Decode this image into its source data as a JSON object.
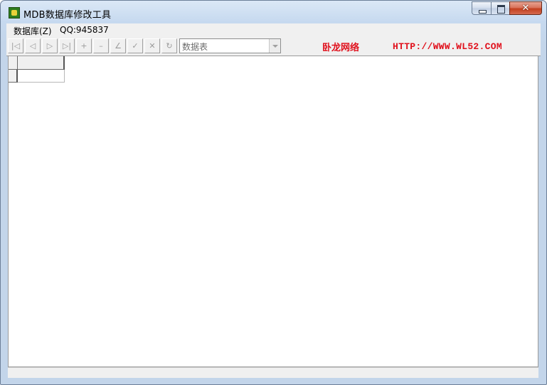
{
  "window": {
    "title": "MDB数据库修改工具",
    "icon": "app-icon",
    "close_glyph": "✕"
  },
  "menu": {
    "items": [
      {
        "label": "数据库(Z)"
      },
      {
        "label": "QQ:945837"
      }
    ]
  },
  "toolbar": {
    "buttons": [
      {
        "icon": "first-record-icon",
        "glyph": "|◁"
      },
      {
        "icon": "prior-record-icon",
        "glyph": "◁"
      },
      {
        "icon": "next-record-icon",
        "glyph": "▷"
      },
      {
        "icon": "last-record-icon",
        "glyph": "▷|"
      },
      {
        "icon": "insert-record-icon",
        "glyph": "+"
      },
      {
        "icon": "delete-record-icon",
        "glyph": "–"
      },
      {
        "icon": "edit-record-icon",
        "glyph": "∠"
      },
      {
        "icon": "post-record-icon",
        "glyph": "✓"
      },
      {
        "icon": "cancel-edit-icon",
        "glyph": "✕"
      },
      {
        "icon": "refresh-icon",
        "glyph": "↻"
      }
    ],
    "table_select": {
      "value": "数据表"
    },
    "brand": "卧龙网络",
    "url": "HTTP://WWW.WL52.COM"
  },
  "colors": {
    "brand": "#e0101c",
    "disabled_icon": "#9b9b9b"
  }
}
